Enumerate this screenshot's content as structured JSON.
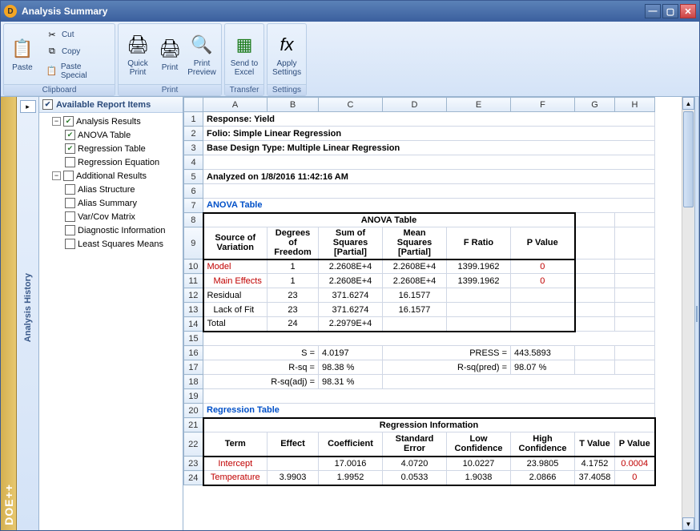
{
  "window": {
    "title": "Analysis Summary"
  },
  "ribbon": {
    "paste": "Paste",
    "cut": "Cut",
    "copy": "Copy",
    "paste_special": "Paste Special",
    "clipboard": "Clipboard",
    "quick_print": "Quick\nPrint",
    "print": "Print",
    "print_preview": "Print\nPreview",
    "print_group": "Print",
    "send_excel": "Send to\nExcel",
    "transfer": "Transfer",
    "apply_settings": "Apply\nSettings",
    "settings": "Settings"
  },
  "side": {
    "history": "Analysis History",
    "brand": "DOE++"
  },
  "tree": {
    "header": "Available Report Items",
    "analysis_results": "Analysis Results",
    "anova_table": "ANOVA Table",
    "regression_table": "Regression Table",
    "regression_equation": "Regression Equation",
    "additional_results": "Additional Results",
    "alias_structure": "Alias Structure",
    "alias_summary": "Alias Summary",
    "varcov": "Var/Cov Matrix",
    "diagnostic": "Diagnostic Information",
    "lsm": "Least Squares Means"
  },
  "cols": [
    "A",
    "B",
    "C",
    "D",
    "E",
    "F",
    "G",
    "H"
  ],
  "rows": {
    "r1": "Response: Yield",
    "r2": "Folio: Simple Linear Regression",
    "r3": "Base Design Type: Multiple Linear Regression",
    "r5": "Analyzed on 1/8/2016 11:42:16 AM",
    "r7": "ANOVA Table",
    "r8_title": "ANOVA Table",
    "hdr": {
      "src": "Source of Variation",
      "dof": "Degrees of Freedom",
      "ssp": "Sum of Squares [Partial]",
      "msp": "Mean Squares [Partial]",
      "f": "F Ratio",
      "p": "P Value"
    },
    "model": {
      "a": "Model",
      "b": "1",
      "c": "2.2608E+4",
      "d": "2.2608E+4",
      "e": "1399.1962",
      "f": "0"
    },
    "maineff": {
      "a": "Main Effects",
      "b": "1",
      "c": "2.2608E+4",
      "d": "2.2608E+4",
      "e": "1399.1962",
      "f": "0"
    },
    "residual": {
      "a": "Residual",
      "b": "23",
      "c": "371.6274",
      "d": "16.1577"
    },
    "lof": {
      "a": "Lack of Fit",
      "b": "23",
      "c": "371.6274",
      "d": "16.1577"
    },
    "total": {
      "a": "Total",
      "b": "24",
      "c": "2.2979E+4"
    },
    "s_lbl": "S =",
    "s_val": "4.0197",
    "press_lbl": "PRESS =",
    "press_val": "443.5893",
    "rsq_lbl": "R-sq =",
    "rsq_val": "98.38 %",
    "rsqp_lbl": "R-sq(pred) =",
    "rsqp_val": "98.07 %",
    "rsqa_lbl": "R-sq(adj) =",
    "rsqa_val": "98.31 %",
    "r20": "Regression Table",
    "r21": "Regression Information",
    "reghdr": {
      "term": "Term",
      "eff": "Effect",
      "coef": "Coefficient",
      "se": "Standard Error",
      "lc": "Low Confidence",
      "hc": "High Confidence",
      "t": "T Value",
      "p": "P Value"
    },
    "intercept": {
      "a": "Intercept",
      "c": "17.0016",
      "d": "4.0720",
      "e": "10.0227",
      "f": "23.9805",
      "g": "4.1752",
      "h": "0.0004"
    },
    "temp": {
      "a": "Temperature",
      "b": "3.9903",
      "c": "1.9952",
      "d": "0.0533",
      "e": "1.9038",
      "f": "2.0866",
      "g": "37.4058",
      "h": "0"
    }
  }
}
